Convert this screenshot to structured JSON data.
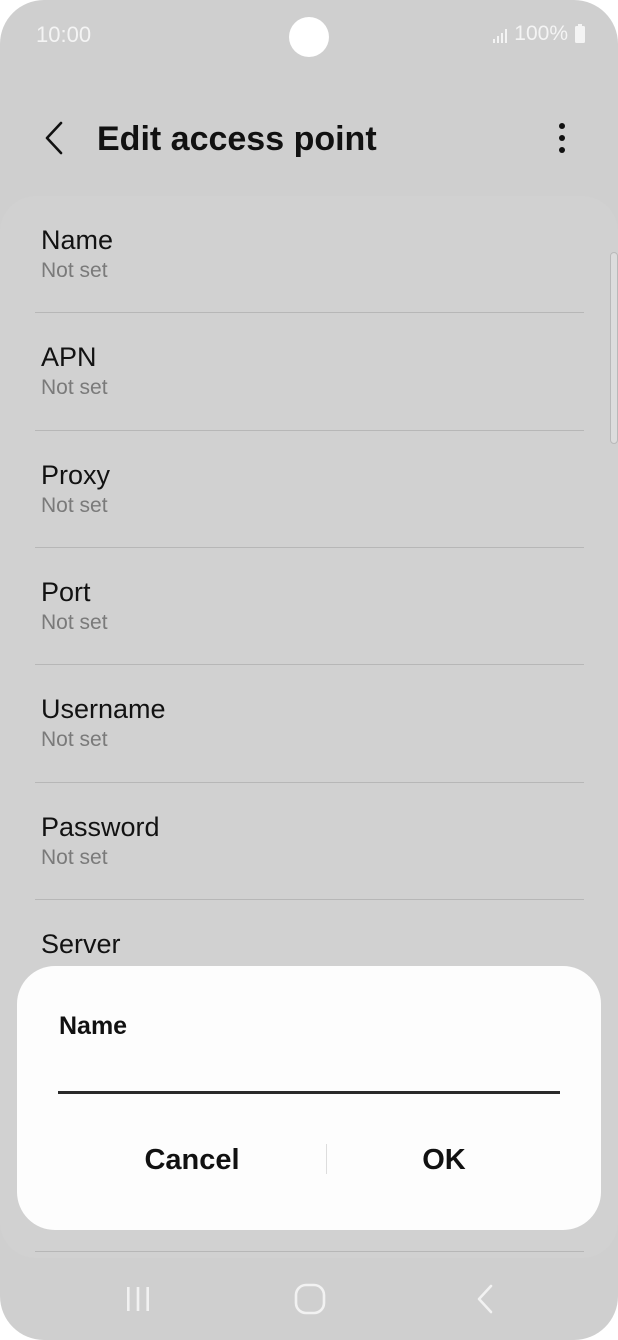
{
  "status_bar": {
    "time": "10:00",
    "battery": "100%"
  },
  "app_bar": {
    "title": "Edit access point",
    "back_icon": "chevron-left-icon",
    "more_icon": "more-vertical-icon"
  },
  "settings": {
    "items": [
      {
        "title": "Name",
        "value": "Not set"
      },
      {
        "title": "APN",
        "value": "Not set"
      },
      {
        "title": "Proxy",
        "value": "Not set"
      },
      {
        "title": "Port",
        "value": "Not set"
      },
      {
        "title": "Username",
        "value": "Not set"
      },
      {
        "title": "Password",
        "value": "Not set"
      },
      {
        "title": "Server",
        "value": ""
      }
    ]
  },
  "dialog": {
    "title": "Name",
    "input_value": "",
    "cancel_label": "Cancel",
    "ok_label": "OK"
  },
  "nav_bar": {
    "icons": [
      "recents-icon",
      "home-icon",
      "back-icon"
    ]
  },
  "colors": {
    "background": "#cfcfcf",
    "card": "#d1d1d1",
    "dialog": "#fdfdfd",
    "text_primary": "#111111",
    "text_secondary": "#7a7a7a"
  }
}
